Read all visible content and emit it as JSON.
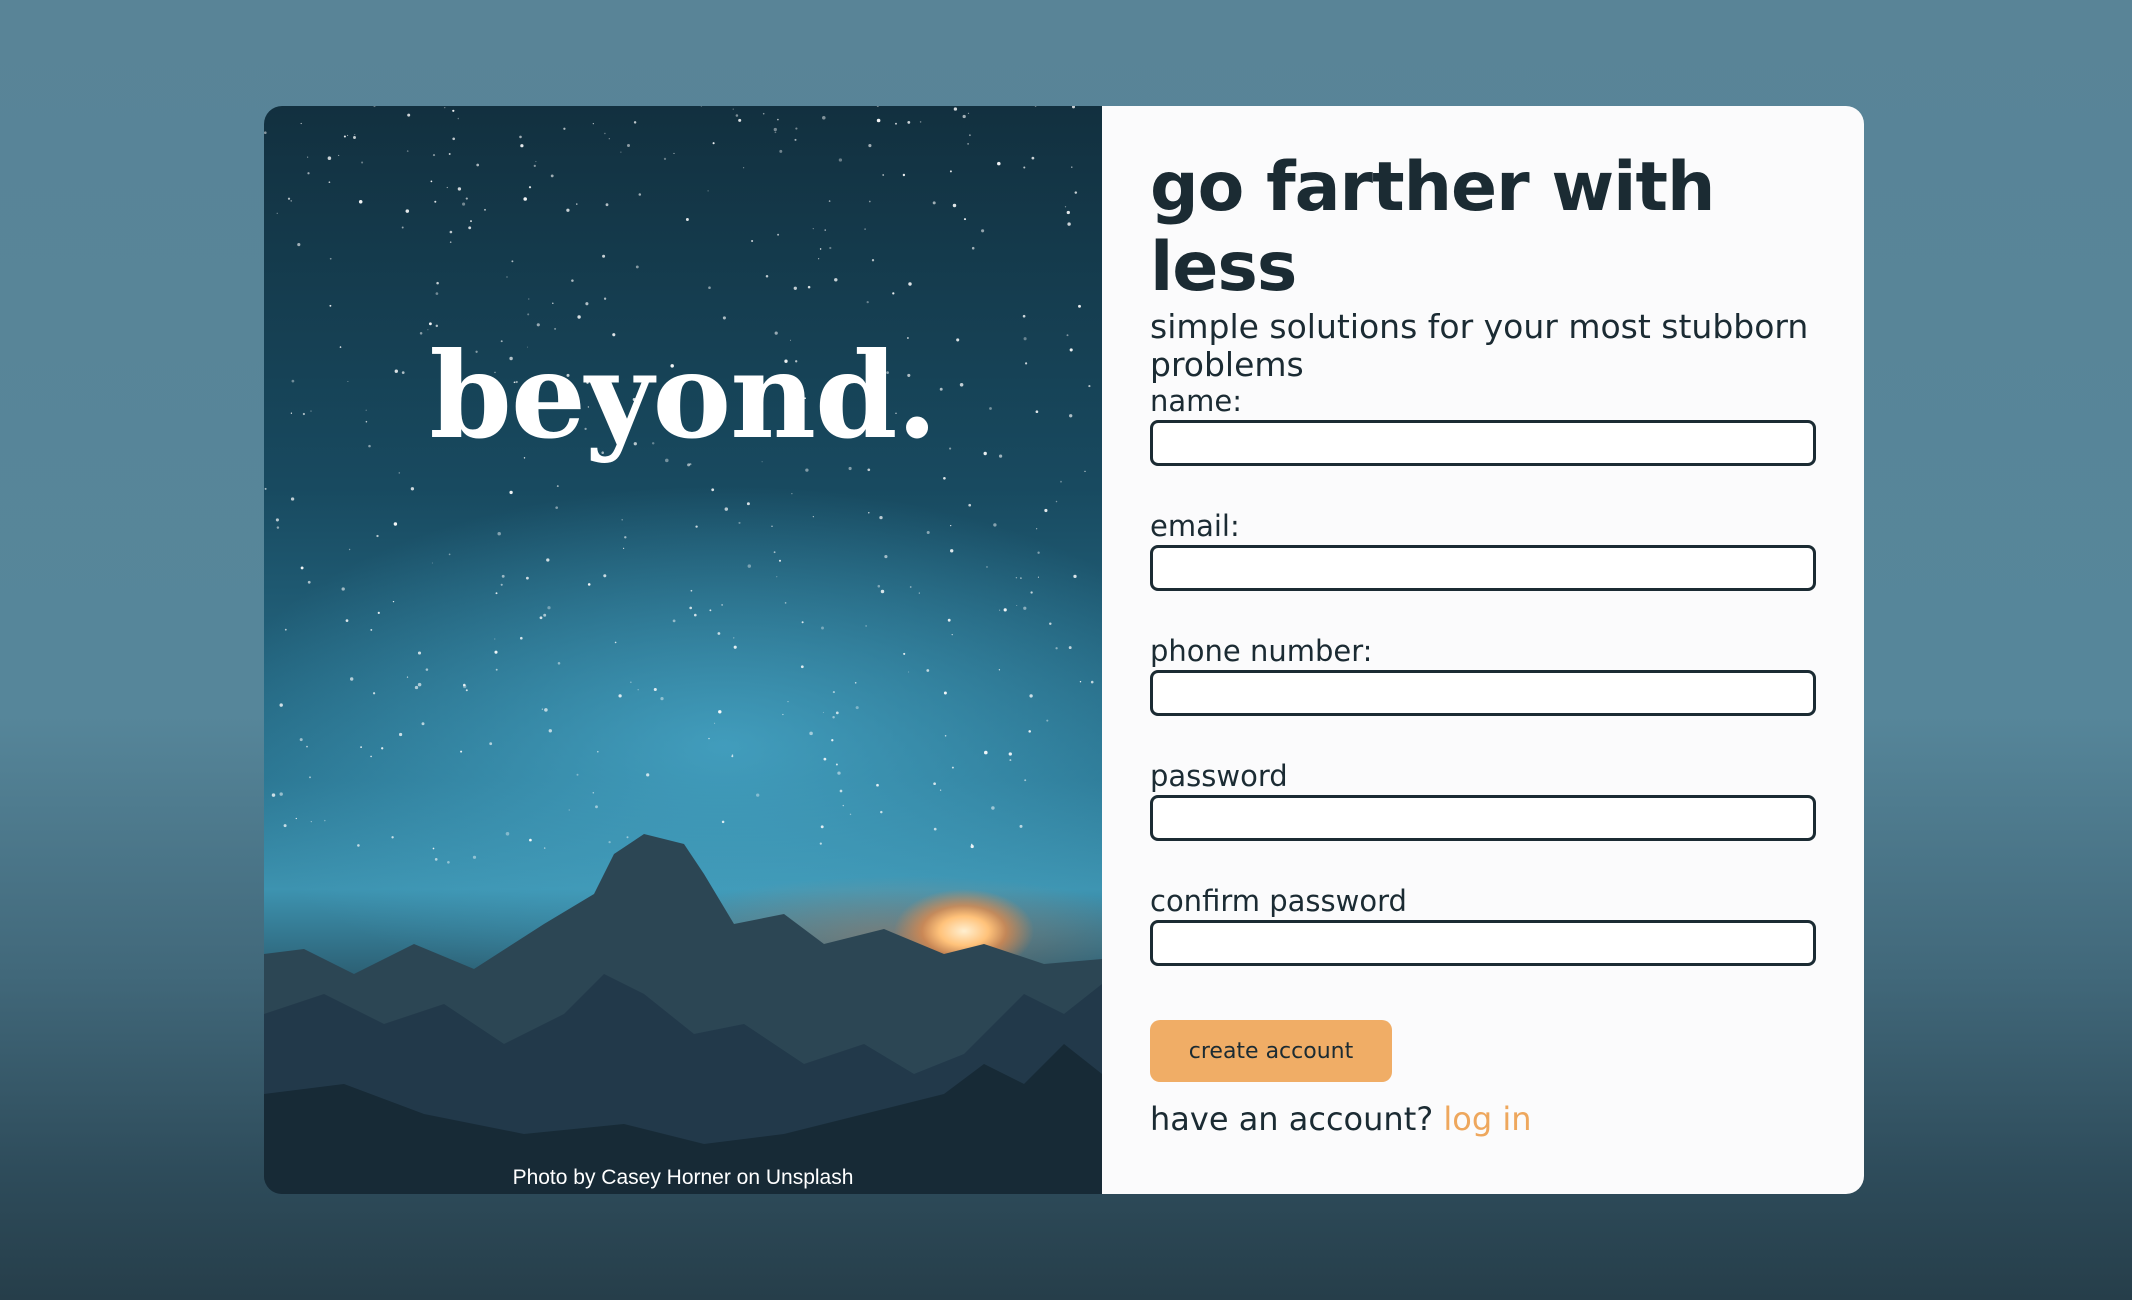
{
  "brand": {
    "name": "beyond."
  },
  "photo": {
    "credit": "Photo by Casey Horner on Unsplash"
  },
  "header": {
    "title": "go farther with less",
    "subtitle": "simple solutions for your most stubborn problems"
  },
  "form": {
    "fields": [
      {
        "label": "name:",
        "value": "",
        "placeholder": ""
      },
      {
        "label": "email:",
        "value": "",
        "placeholder": ""
      },
      {
        "label": "phone number:",
        "value": "",
        "placeholder": ""
      },
      {
        "label": "password",
        "value": "",
        "placeholder": ""
      },
      {
        "label": "confirm password",
        "value": "",
        "placeholder": ""
      }
    ],
    "submit_label": "create account",
    "login_prompt": "have an account?",
    "login_link": "log in"
  },
  "colors": {
    "accent": "#f0ad66",
    "link": "#eea75d",
    "text": "#1b2b33",
    "panel": "#fbfbfc"
  }
}
